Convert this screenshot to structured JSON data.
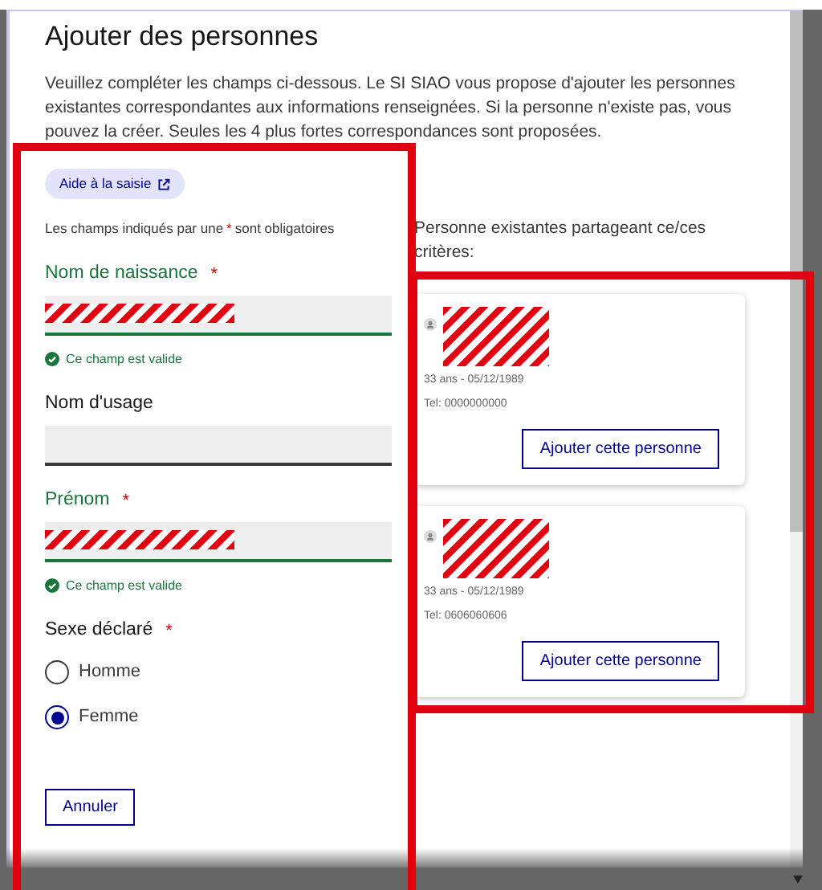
{
  "dialog": {
    "title": "Ajouter des personnes",
    "intro": "Veuillez compléter les champs ci-dessous. Le SI SIAO vous propose d'ajouter les personnes existantes correspondantes aux informations renseignées. Si la personne n'existe pas, vous pouvez la créer. Seules les 4 plus fortes correspondances sont proposées."
  },
  "form": {
    "help_link": "Aide à la saisie",
    "note_before": "Les champs indiqués par une",
    "note_mark": "*",
    "note_after": "sont obligatoires",
    "fields": [
      {
        "kind": "text",
        "label": "Nom de naissance",
        "required_mark": "*",
        "valid": true,
        "message": "Ce champ est valide",
        "redacted": true
      },
      {
        "kind": "text",
        "label": "Nom d'usage",
        "valid": false,
        "redacted": false
      },
      {
        "kind": "text",
        "label": "Prénom",
        "required_mark": "*",
        "valid": true,
        "message": "Ce champ est valide",
        "redacted": true
      },
      {
        "kind": "radio",
        "label": "Sexe déclaré",
        "required_mark": "*",
        "options": [
          {
            "label": "Homme",
            "selected": false
          },
          {
            "label": "Femme",
            "selected": true
          }
        ]
      }
    ],
    "cancel": "Annuler"
  },
  "matches": {
    "heading": "Personne existantes partageant ce/ces critères:",
    "items": [
      {
        "age_date": "33 ans - 05/12/1989",
        "phone": "Tel: 0000000000",
        "action": "Ajouter cette personne"
      },
      {
        "age_date": "33 ans - 05/12/1989",
        "phone": "Tel: 0606060606",
        "action": "Ajouter cette personne"
      }
    ]
  }
}
